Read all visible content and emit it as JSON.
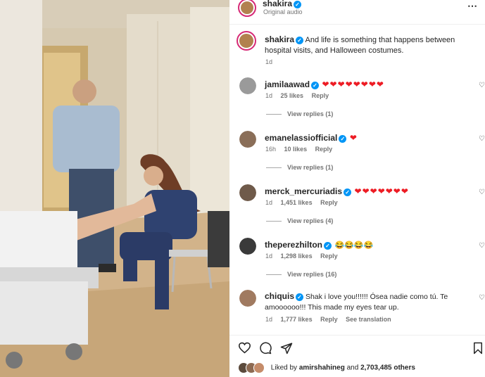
{
  "post_header": {
    "username": "shakira",
    "audio": "Original audio",
    "more_icon": "ellipsis-icon"
  },
  "caption": {
    "username": "shakira",
    "text": "And life is something that happens between hospital visits, and Halloween costumes.",
    "time": "1d"
  },
  "comments": [
    {
      "username": "jamilaawad",
      "text": "❤❤❤❤❤❤❤❤",
      "time": "1d",
      "likes": "25 likes",
      "reply": "Reply",
      "view_replies": "View replies (1)",
      "avatar_color": "#9a9a9a"
    },
    {
      "username": "emanelassiofficial",
      "text": "❤",
      "time": "16h",
      "likes": "10 likes",
      "reply": "Reply",
      "view_replies": "View replies (1)",
      "avatar_color": "#8a6e58"
    },
    {
      "username": "merck_mercuriadis",
      "text": "❤❤❤❤❤❤❤",
      "time": "1d",
      "likes": "1,451 likes",
      "reply": "Reply",
      "view_replies": "View replies (4)",
      "avatar_color": "#6f5a4a"
    },
    {
      "username": "theperezhilton",
      "text": "😂😂😂😂",
      "time": "1d",
      "likes": "1,298 likes",
      "reply": "Reply",
      "view_replies": "View replies (16)",
      "avatar_color": "#3a3a3a"
    },
    {
      "username": "chiquis",
      "text": "Shak i love you!!!!!! Ósea nadie como tú. Te amoooooo!!! This made my eyes tear up.",
      "time": "1d",
      "likes": "1,777 likes",
      "reply": "Reply",
      "see_translation": "See translation",
      "avatar_color": "#a07a60"
    }
  ],
  "liked_by": {
    "prefix": "Liked by",
    "user": "amirshahineg",
    "and": "and",
    "count": "2,703,485 others"
  },
  "icons": {
    "like": "heart-outline-icon",
    "comment": "comment-bubble-icon",
    "share": "paper-plane-icon",
    "save": "bookmark-icon"
  },
  "colors": {
    "verified": "#0095f6",
    "story_ring": "#d62976",
    "heart_red": "#ed1c24",
    "secondary_text": "#737373"
  }
}
